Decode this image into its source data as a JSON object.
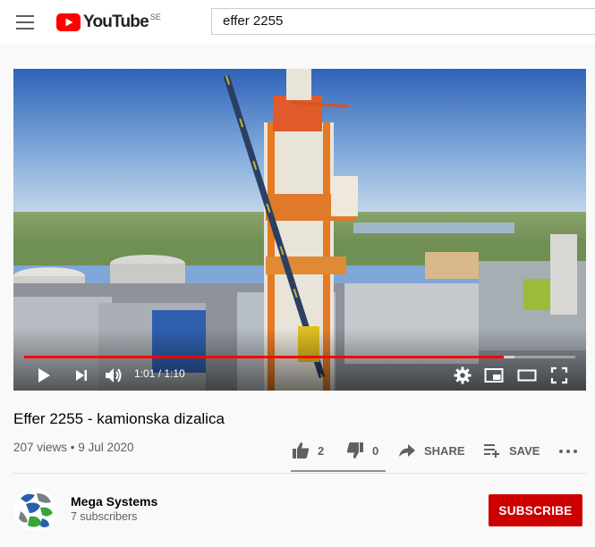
{
  "header": {
    "logo_text": "YouTube",
    "country_code": "SE",
    "search_value": "effer 2255"
  },
  "player": {
    "time_display": "1:01 / 1:10",
    "progress_fraction": 0.87,
    "buffered_fraction": 0.89
  },
  "video": {
    "title": "Effer 2255 - kamionska dizalica",
    "views_date": "207 views • 9 Jul 2020"
  },
  "actions": {
    "like_count": "2",
    "dislike_count": "0",
    "share_label": "SHARE",
    "save_label": "SAVE"
  },
  "channel": {
    "name": "Mega Systems",
    "subscribers": "7 subscribers",
    "subscribe_label": "SUBSCRIBE"
  },
  "colors": {
    "accent_red": "#ff0000",
    "subscribe_red": "#cc0000"
  },
  "icons": [
    "menu-icon",
    "youtube-logo-icon",
    "play-icon",
    "next-icon",
    "volume-icon",
    "settings-icon",
    "miniplayer-icon",
    "theater-icon",
    "fullscreen-icon",
    "like-icon",
    "dislike-icon",
    "share-icon",
    "save-icon",
    "more-icon"
  ]
}
